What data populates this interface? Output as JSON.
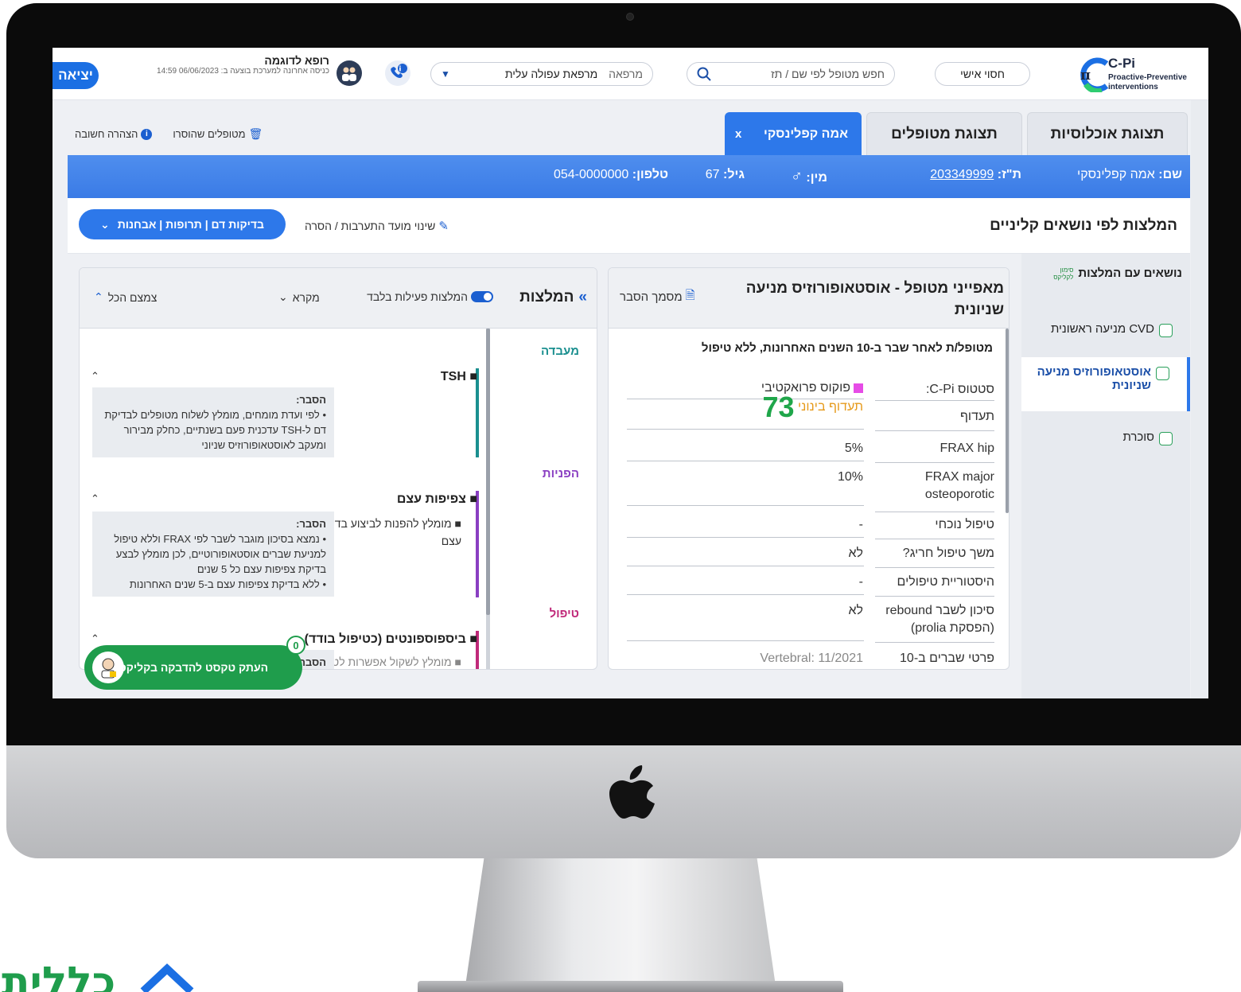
{
  "app": {
    "logo_title": "C-Pi",
    "logo_subtitle": "Proactive-Preventive interventions",
    "personal_button": "חסוי אישי",
    "search_placeholder": "חפש מטופל לפי שם / תז",
    "clinic_label": "מרפאה",
    "clinic_value": "מרפאת עפולה עלית",
    "user_name": "רופא לדוגמה",
    "last_login": "כניסה אחרונה למערכת בוצעה ב: 06/06/2023 14:59",
    "exit_button": "יציאה"
  },
  "tabs": {
    "populations": "תצוגת אוכלוסיות",
    "patients": "תצוגת מטופלים",
    "patient": "אמה קפלינסקי",
    "close": "x"
  },
  "tools": {
    "important_notice": "הצהרה חשובה",
    "removed_patients": "מטופלים שהוסרו"
  },
  "patient": {
    "name_label": "שם:",
    "name": "אמה קפלינסקי",
    "id_label": "ת\"ז:",
    "id": "203349999",
    "gender_label": "מין:",
    "gender_symbol": "♂",
    "age_label": "גיל:",
    "age": "67",
    "phone_label": "טלפון:",
    "phone": "054-0000000"
  },
  "section": {
    "title": "המלצות לפי נושאים קליניים",
    "change_link": "שינוי מועד התערבות / הסרה",
    "tests_button": "בדיקות דם | תרופות | אבחנות"
  },
  "topics": {
    "title": "נושאים עם המלצות",
    "hint": "סימון לקליקס",
    "items": [
      {
        "label": "CVD מניעה ראשונית"
      },
      {
        "label": "אוסטאופורוזיס מניעה שניונית"
      },
      {
        "label": "סוכרת"
      }
    ]
  },
  "characteristics": {
    "title": "מאפייני מטופל - אוסטאופורוזיס מניעה שניונית",
    "doc_link": "מסמך הסבר",
    "subtitle": "מטופל/ת לאחר שבר ב-10 השנים האחרונות, ללא טיפול",
    "rows": [
      {
        "label": "סטטוס C-Pi:",
        "value": "פוקוס פרואקטיבי"
      },
      {
        "label": "תעדוף",
        "value": "תעדוף בינוני",
        "score": "73"
      },
      {
        "label": "FRAX hip",
        "value": "5%"
      },
      {
        "label": "FRAX major osteoporotic",
        "value": "10%"
      },
      {
        "label": "טיפול נוכחי",
        "value": "-"
      },
      {
        "label": "משך טיפול חריג?",
        "value": "לא"
      },
      {
        "label": "היסטוריית טיפולים",
        "value": "-"
      },
      {
        "label": "סיכון לשבר rebound (הפסקת prolia)",
        "value": "לא"
      },
      {
        "label": "פרטי שברים ב-10",
        "value": "Vertebral: 11/2021"
      }
    ]
  },
  "recommendations": {
    "title": "המלצות",
    "active_only": "המלצות פעילות בלבד",
    "legend": "מקרא",
    "collapse_all": "צמצם הכל",
    "categories": {
      "lab": "מעבדה",
      "referrals": "הפניות",
      "treatment": "טיפול"
    },
    "lab_item": "TSH",
    "lab_expl_title": "הסבר:",
    "lab_expl": "לפי ועדת מומחים, מומלץ לשלוח מטופלים לבדיקת דם ל-TSH עדכנית פעם בשנתיים, כחלק מבירור ומעקב לאוסטאופורוזיס שניוני",
    "ref_item": "צפיפות עצם",
    "ref_sub": "מומלץ להפנות לביצוע בדיקת צפיפות עצם",
    "ref_expl_title": "הסבר:",
    "ref_expl_1": "נמצא בסיכון מוגבר לשבר לפי FRAX וללא טיפול למניעת שברים אוסטאופורוטיים, לכן מומלץ לבצע בדיקת צפיפות עצם כל 5 שנים",
    "ref_expl_2": "ללא בדיקת צפיפות עצם ב-5 שנים האחרונות",
    "treat_item": "ביספוספונטים (כטיפול בודד)",
    "treat_sub": "מומלץ לשקול אפשרות לטיפול",
    "treat_expl_title": "הסבר"
  },
  "copy_button": {
    "label": "העתק טקסט להדבקה בקליקס",
    "count": "0"
  },
  "brand": {
    "name": "כללית"
  },
  "colors": {
    "primary_blue": "#2d78ea",
    "green": "#1f9d4c",
    "lab": "#1a8f8f",
    "referrals": "#8a3fc2",
    "treatment": "#c02a7a",
    "priority_orange": "#e69a1a",
    "focus_pink": "#e64ce6"
  }
}
